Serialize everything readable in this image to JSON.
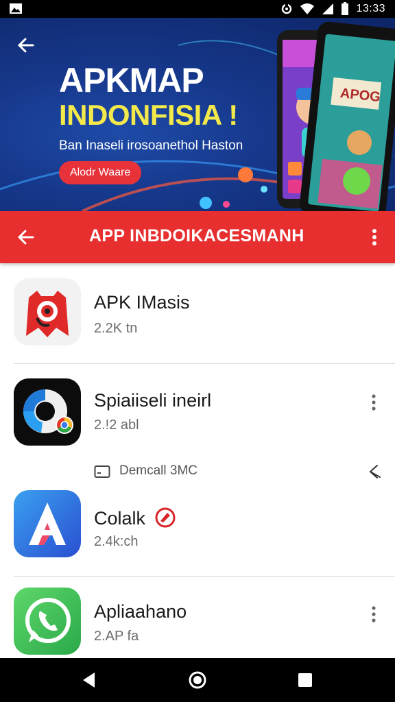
{
  "status_bar": {
    "time": "13:33",
    "icons": [
      "gallery-icon",
      "sync-icon",
      "wifi-icon",
      "signal-icon",
      "battery-icon"
    ]
  },
  "banner": {
    "title_line1": "APKMAP",
    "title_line2": "INDONFISIA !",
    "tagline": "Ban Inaseli irosoanethol Haston",
    "cta_label": "Alodr Waare",
    "accent_color": "#f3e94a",
    "background_color": "#16378a"
  },
  "toolbar": {
    "title": "APP INBDOIKACESMANH",
    "color": "#e82f2f"
  },
  "apps": [
    {
      "name": "APK IMasis",
      "size": "2.2K tn",
      "icon": "red-mask-icon"
    },
    {
      "name": "Spiaiiseli ineirl",
      "size": "2.!2 abl",
      "icon": "donut-chrome-icon"
    },
    {
      "name": "Colalk",
      "size": "2.4k:ch",
      "icon": "letter-a-icon"
    },
    {
      "name": "Apliaahano",
      "size": "2.AP fa",
      "icon": "chat-phone-icon"
    }
  ],
  "sub_row": {
    "label": "Demcall 3MC",
    "icon": "screen-icon"
  },
  "nav_bar": {
    "buttons": [
      "back-triangle-icon",
      "home-circle-icon",
      "recents-square-icon"
    ]
  }
}
